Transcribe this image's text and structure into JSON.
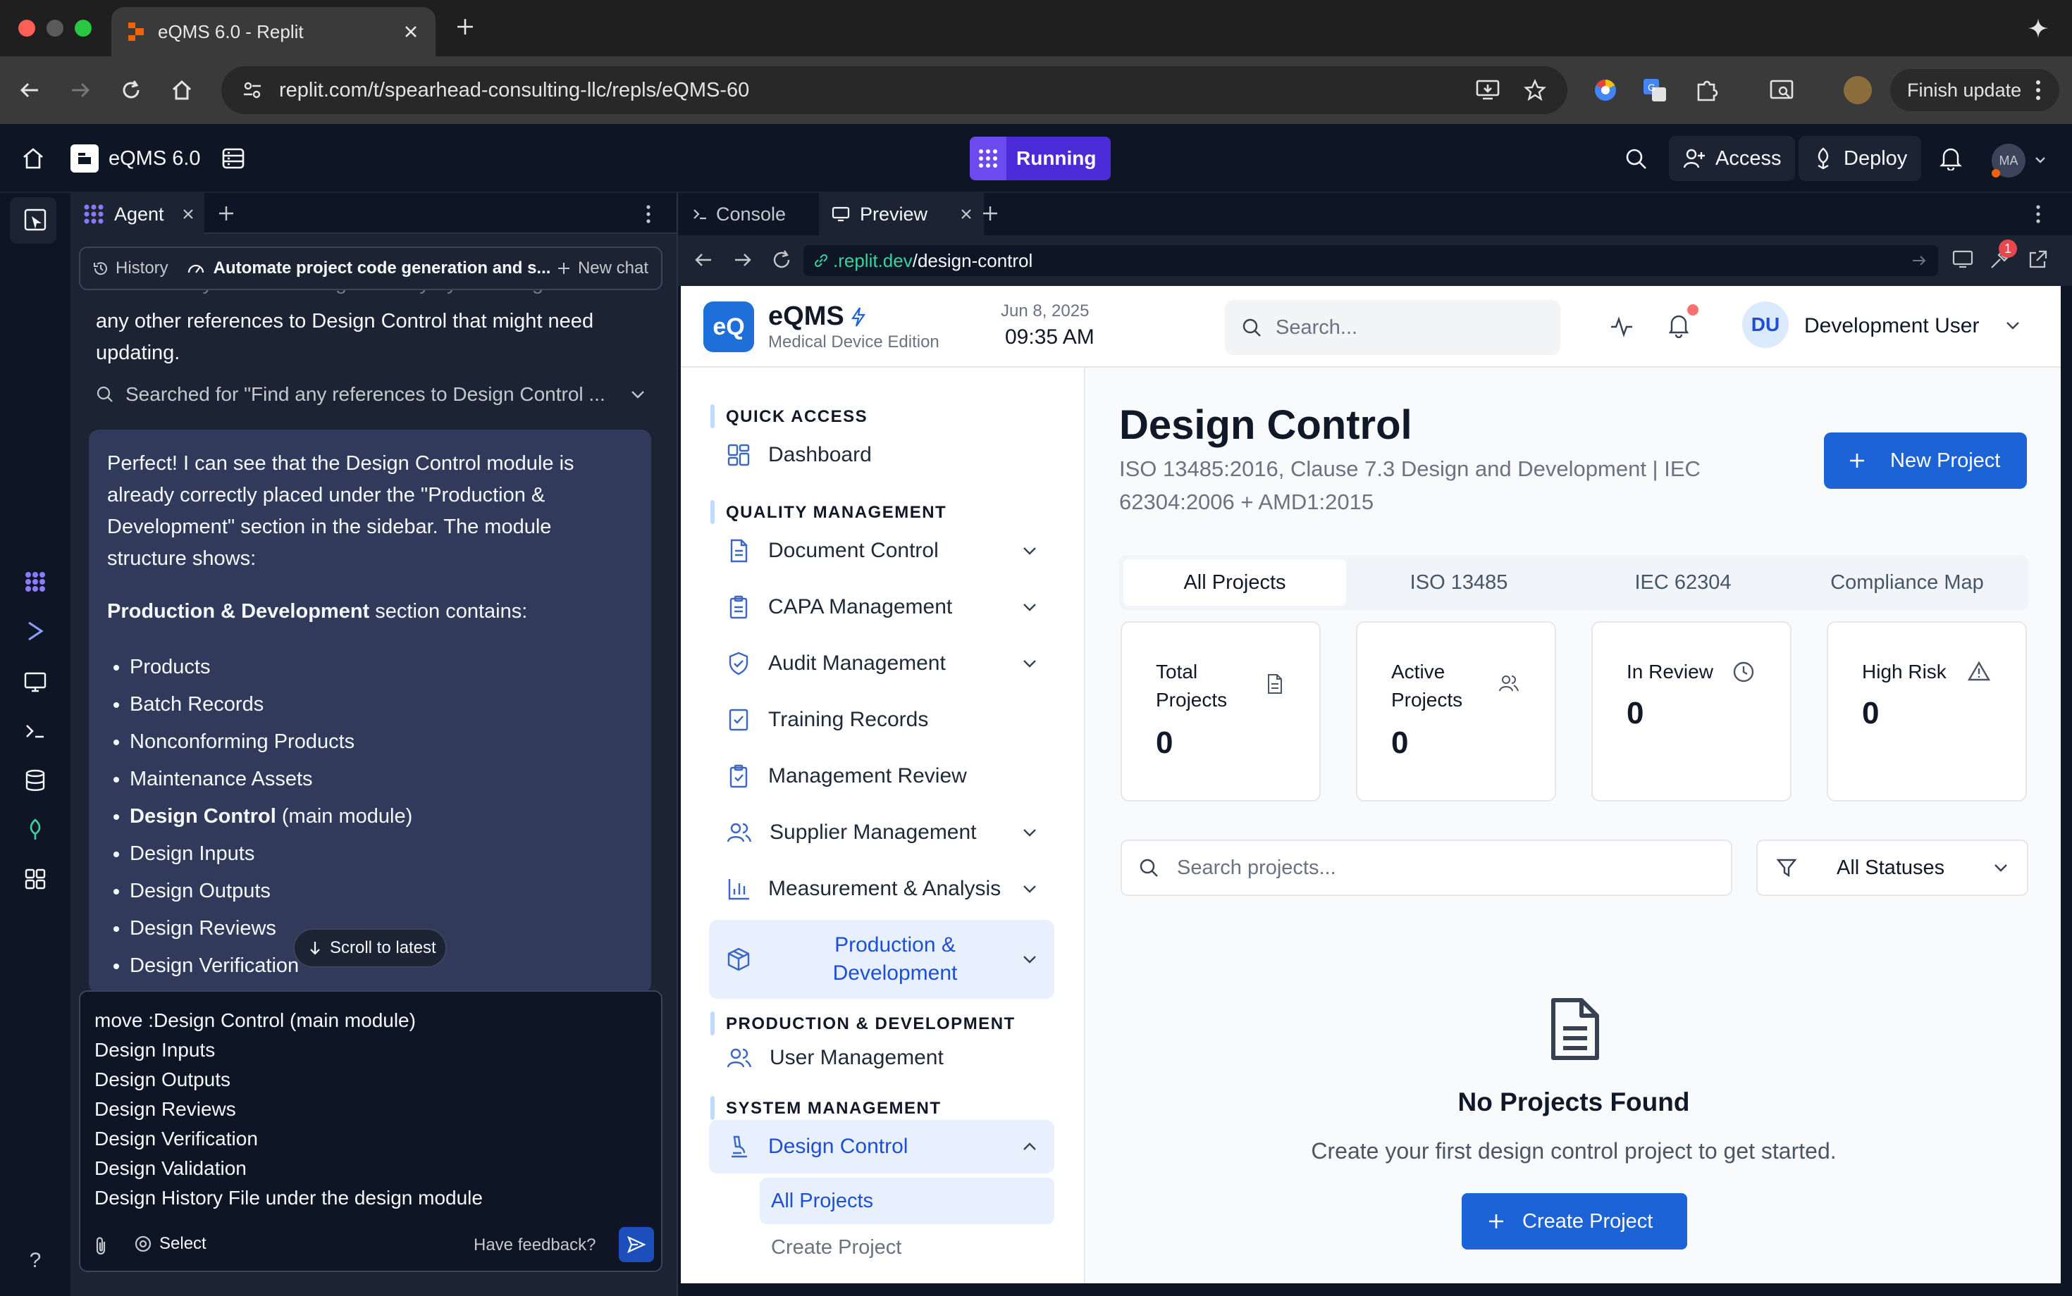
{
  "browser": {
    "tab_title": "eQMS 6.0 - Replit",
    "url": "replit.com/t/spearhead-consulting-llc/repls/eQMS-60",
    "finish_update": "Finish update"
  },
  "replit": {
    "project_name": "eQMS 6.0",
    "status": "Running",
    "access": "Access",
    "deploy": "Deploy",
    "avatar": "MA"
  },
  "agent": {
    "tab": "Agent",
    "history": "History",
    "chat_title": "Automate project code generation and s...",
    "new_chat": "New chat",
    "faded_text": "Let me verify this is working correctly by checking if there are",
    "intro_text": "any other references to Design Control that might need updating.",
    "searched": "Searched for \"Find any references to Design Control ...",
    "message_p1": "Perfect! I can see that the Design Control module is already correctly placed under the \"Production & Development\" section in the sidebar. The module structure shows:",
    "message_bold": "Production & Development",
    "message_p2": " section contains:",
    "list": [
      "Products",
      "Batch Records",
      "Nonconforming Products",
      "Maintenance Assets"
    ],
    "list_bold": "Design Control",
    "list_bold_suffix": " (main module)",
    "list2": [
      "Design Inputs",
      "Design Outputs",
      "Design Reviews",
      "Design Verification",
      "Design Validation"
    ],
    "scroll_latest": "Scroll to latest",
    "composer_lines": [
      "move :Design Control (main module)",
      "Design Inputs",
      "Design Outputs",
      "Design Reviews",
      "Design Verification",
      "Design Validation",
      "Design History File  under the design module"
    ],
    "select": "Select",
    "feedback": "Have feedback?"
  },
  "preview": {
    "console_tab": "Console",
    "preview_tab": "Preview",
    "url_host": ".replit.dev",
    "url_path": "/design-control",
    "badge": "1"
  },
  "app": {
    "brand": "eQMS",
    "edition": "Medical Device Edition",
    "date": "Jun 8, 2025",
    "time": "09:35 AM",
    "search_placeholder": "Search...",
    "user_initials": "DU",
    "user_name": "Development User",
    "sidebar": {
      "quick_access": "QUICK ACCESS",
      "dashboard": "Dashboard",
      "quality_management": "QUALITY MANAGEMENT",
      "document_control": "Document Control",
      "capa": "CAPA Management",
      "audit": "Audit Management",
      "training": "Training Records",
      "mgmt_review": "Management Review",
      "supplier": "Supplier Management",
      "measurement": "Measurement & Analysis",
      "prod_dev_l1": "Production &",
      "prod_dev_l2": "Development",
      "prod_dev_section": "PRODUCTION & DEVELOPMENT",
      "user_mgmt": "User Management",
      "system_mgmt": "SYSTEM MANAGEMENT",
      "design_control": "Design Control",
      "all_projects": "All Projects",
      "create_project": "Create Project"
    },
    "page_title": "Design Control",
    "page_subtitle_l1": "ISO 13485:2016, Clause 7.3 Design and Development | IEC",
    "page_subtitle_l2": "62304:2006 + AMD1:2015",
    "new_project": "New Project",
    "tabs": [
      "All Projects",
      "ISO 13485",
      "IEC 62304",
      "Compliance Map"
    ],
    "cards": [
      {
        "label_l1": "Total",
        "label_l2": "Projects",
        "value": "0"
      },
      {
        "label_l1": "Active",
        "label_l2": "Projects",
        "value": "0"
      },
      {
        "label_l1": "In Review",
        "label_l2": "",
        "value": "0"
      },
      {
        "label_l1": "High Risk",
        "label_l2": "",
        "value": "0"
      }
    ],
    "project_search": "Search projects...",
    "status_filter": "All Statuses",
    "empty_title": "No Projects Found",
    "empty_text": "Create your first design control project to get started.",
    "create_project": "Create Project"
  }
}
